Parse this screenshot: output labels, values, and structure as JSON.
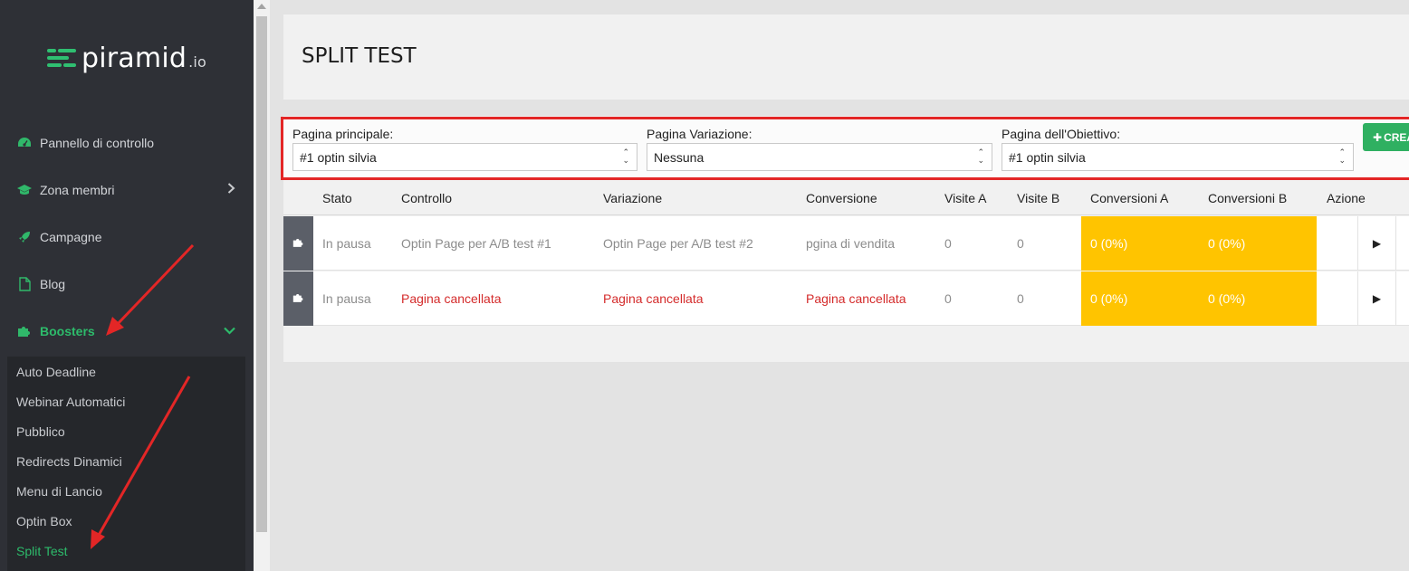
{
  "brand": {
    "name": "piramid",
    "suffix": ".io"
  },
  "sidebar": {
    "items": [
      {
        "label": "Pannello di controllo",
        "icon": "dashboard-icon"
      },
      {
        "label": "Zona membri",
        "icon": "graduation-cap-icon"
      },
      {
        "label": "Campagne",
        "icon": "rocket-icon"
      },
      {
        "label": "Blog",
        "icon": "file-icon"
      },
      {
        "label": "Boosters",
        "icon": "puzzle-icon"
      }
    ],
    "submenu": [
      "Auto Deadline",
      "Webinar Automatici",
      "Pubblico",
      "Redirects Dinamici",
      "Menu di Lancio",
      "Optin Box",
      "Split Test"
    ]
  },
  "page": {
    "title": "SPLIT TEST"
  },
  "filters": {
    "main_label": "Pagina principale:",
    "main_value": "#1 optin silvia",
    "variation_label": "Pagina Variazione:",
    "variation_value": "Nessuna",
    "goal_label": "Pagina dell'Obiettivo:",
    "goal_value": "#1 optin silvia",
    "create_label": "CREA"
  },
  "table": {
    "headers": [
      "Stato",
      "Controllo",
      "Variazione",
      "Conversione",
      "Visite A",
      "Visite B",
      "Conversioni A",
      "Conversioni B",
      "Azione"
    ],
    "rows": [
      {
        "status": "In pausa",
        "control": "Optin Page per A/B test #1",
        "variation": "Optin Page per A/B test #2",
        "conversion": "pgina di vendita",
        "visits_a": "0",
        "visits_b": "0",
        "conv_a": "0 (0%)",
        "conv_b": "0 (0%)"
      },
      {
        "status": "In pausa",
        "control": "Pagina cancellata",
        "variation": "Pagina cancellata",
        "conversion": "Pagina cancellata",
        "visits_a": "0",
        "visits_b": "0",
        "conv_a": "0 (0%)",
        "conv_b": "0 (0%)"
      }
    ]
  },
  "colors": {
    "accent": "#2dbb6b",
    "sidebar": "#2e3036",
    "highlight": "#ffc400",
    "annotation": "#e32626",
    "deleted": "#d42b2b"
  }
}
